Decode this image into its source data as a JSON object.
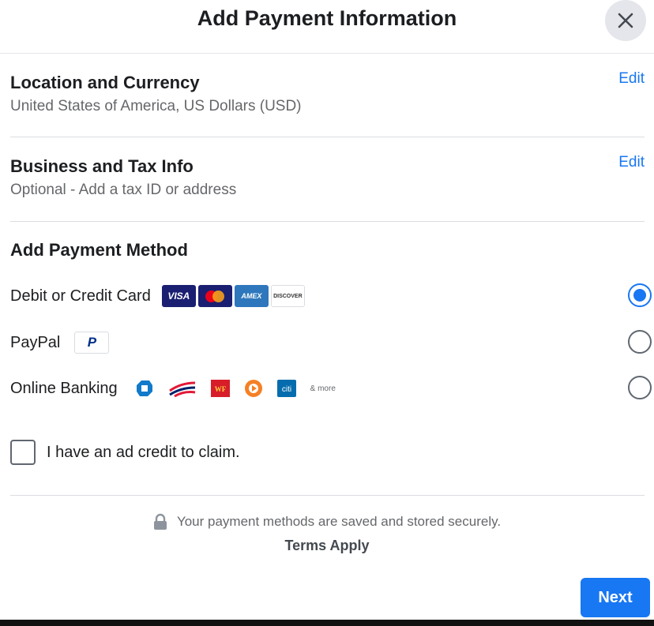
{
  "dialog": {
    "title": "Add Payment Information"
  },
  "location": {
    "title": "Location and Currency",
    "value": "United States of America, US Dollars (USD)",
    "edit_label": "Edit"
  },
  "business": {
    "title": "Business and Tax Info",
    "value": "Optional - Add a tax ID or address",
    "edit_label": "Edit"
  },
  "payment": {
    "title": "Add Payment Method",
    "methods": [
      {
        "label": "Debit or Credit Card",
        "selected": true,
        "logos": [
          "VISA",
          "mastercard",
          "AMEX",
          "DISCOVER"
        ]
      },
      {
        "label": "PayPal",
        "selected": false,
        "logos": [
          "P"
        ]
      },
      {
        "label": "Online Banking",
        "selected": false,
        "logos": [
          "chase",
          "bank-of-america",
          "WF",
          "pnc",
          "citi",
          "& more"
        ]
      }
    ]
  },
  "ad_credit": {
    "label": "I have an ad credit to claim."
  },
  "footer": {
    "secure_text": "Your payment methods are saved and stored securely.",
    "terms_label": "Terms Apply",
    "next_label": "Next"
  },
  "colors": {
    "accent": "#1877f2",
    "visa": "#1a1f71",
    "amex": "#2e77bc",
    "wells_fargo": "#d71e28"
  }
}
